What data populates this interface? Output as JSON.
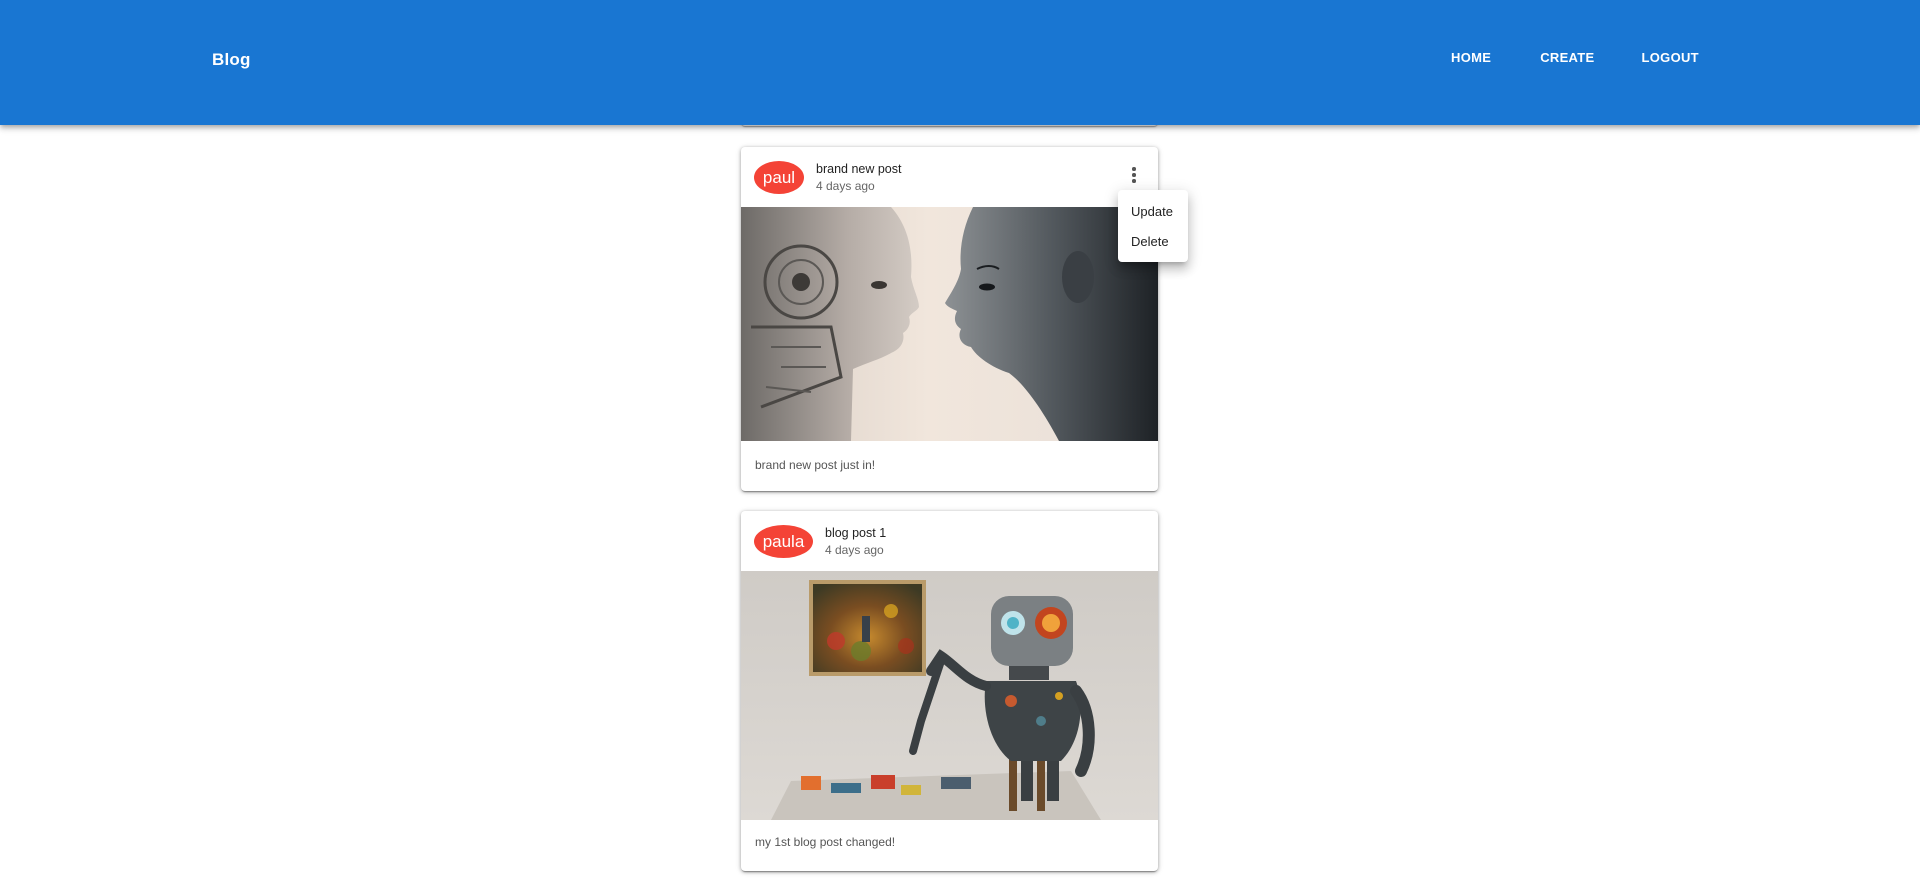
{
  "appbar": {
    "brand": "Blog",
    "nav": [
      "HOME",
      "CREATE",
      "LOGOUT"
    ]
  },
  "posts": [
    {
      "author": "paul",
      "title": "brand new post",
      "date": "4 days ago",
      "body": "brand new post just in!",
      "image": "robot-and-human-face-profile"
    },
    {
      "author": "paula",
      "title": "blog post 1",
      "date": "4 days ago",
      "body": "my 1st blog post changed!",
      "image": "robot-painting-artwork"
    }
  ],
  "post_menu": {
    "items": [
      "Update",
      "Delete"
    ]
  },
  "colors": {
    "appbar": "#1976d2",
    "avatar": "#f44336"
  }
}
